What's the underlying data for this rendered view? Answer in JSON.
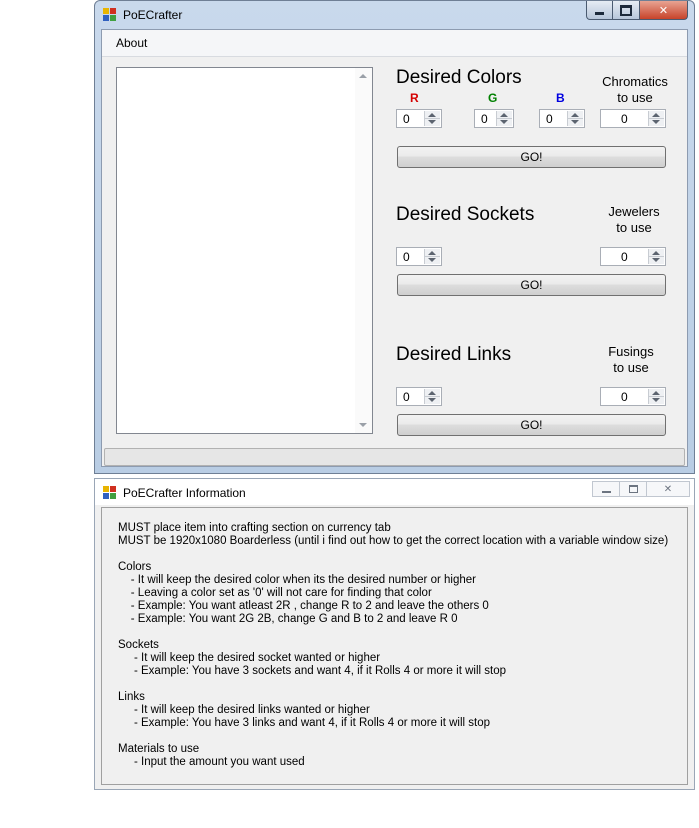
{
  "main_window": {
    "title": "PoECrafter",
    "menu": [
      "About"
    ],
    "colors": {
      "heading": "Desired Colors",
      "red_label": "R",
      "green_label": "G",
      "blue_label": "B",
      "chromatics_label_1": "Chromatics",
      "chromatics_label_2": "to use",
      "red_value": "0",
      "green_value": "0",
      "blue_value": "0",
      "chromatics_value": "0",
      "go_label": "GO!"
    },
    "sockets": {
      "heading": "Desired Sockets",
      "jewelers_label_1": "Jewelers",
      "jewelers_label_2": "to use",
      "sockets_value": "0",
      "jewelers_value": "0",
      "go_label": "GO!"
    },
    "links": {
      "heading": "Desired Links",
      "fusings_label_1": "Fusings",
      "fusings_label_2": "to use",
      "links_value": "0",
      "fusings_value": "0",
      "go_label": "GO!"
    }
  },
  "info_window": {
    "title": "PoECrafter Information",
    "lines": [
      "MUST place item into crafting section on currency tab",
      "MUST be 1920x1080 Boarderless (until i find out how to get the correct location with a variable window size)",
      "",
      "Colors",
      "    - It will keep the desired color when its the desired number or higher",
      "    - Leaving a color set as '0' will not care for finding that color",
      "    - Example: You want atleast 2R , change R to 2 and leave the others 0",
      "    - Example: You want 2G 2B, change G and B to 2 and leave R 0",
      "",
      "Sockets",
      "     - It will keep the desired socket wanted or higher",
      "     - Example: You have 3 sockets and want 4, if it Rolls 4 or more it will stop",
      "",
      "Links",
      "     - It will keep the desired links wanted or higher",
      "     - Example: You have 3 links and want 4, if it Rolls 4 or more it will stop",
      "",
      "Materials to use",
      "     - Input the amount you want used"
    ]
  },
  "colors": {
    "red": "#d40000",
    "green": "#008000",
    "blue": "#0000e0"
  }
}
